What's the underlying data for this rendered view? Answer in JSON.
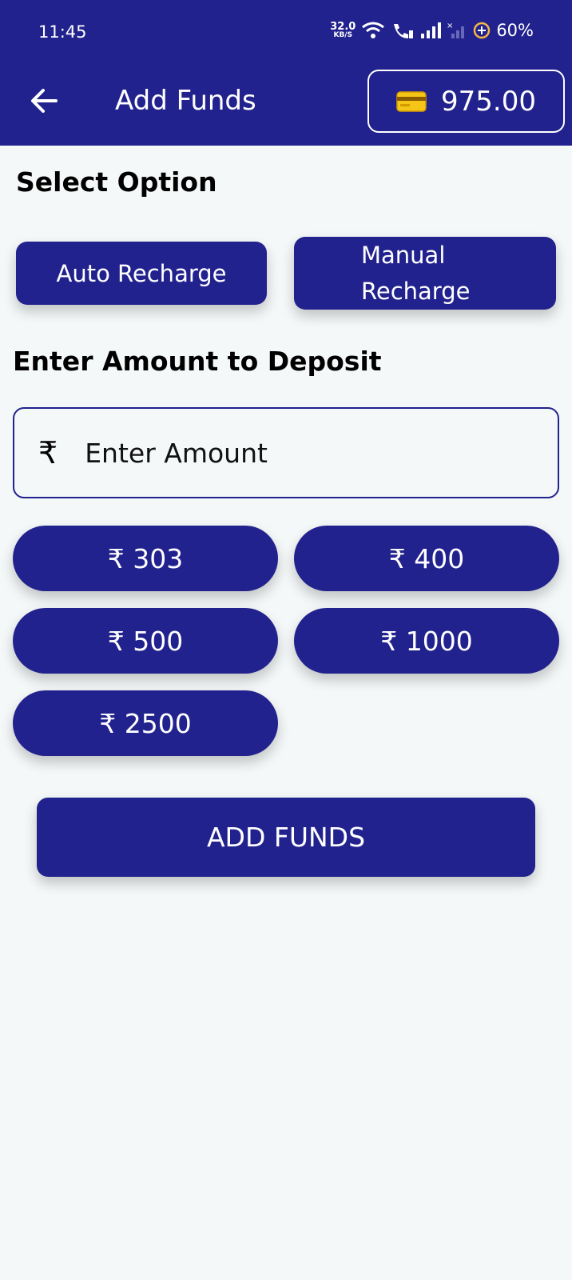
{
  "status_bar": {
    "time": "11:45",
    "speed_value": "32.0",
    "speed_unit": "KB/S",
    "battery": "60%"
  },
  "header": {
    "title": "Add Funds",
    "wallet_balance": "975.00",
    "icons": [
      "back-arrow-icon",
      "wallet-card-icon"
    ]
  },
  "options": {
    "label": "Select Option",
    "auto": "Auto Recharge",
    "manual": "Manual Recharge"
  },
  "deposit": {
    "label": "Enter Amount to Deposit",
    "currency_symbol": "₹",
    "placeholder": "Enter Amount"
  },
  "quick_amounts": [
    "₹ 303",
    "₹ 400",
    "₹ 500",
    "₹ 1000",
    "₹ 2500"
  ],
  "submit": {
    "label": "ADD FUNDS"
  },
  "colors": {
    "primary": "#22228e",
    "background": "#f4f8f8",
    "on_primary": "#ffffff"
  }
}
